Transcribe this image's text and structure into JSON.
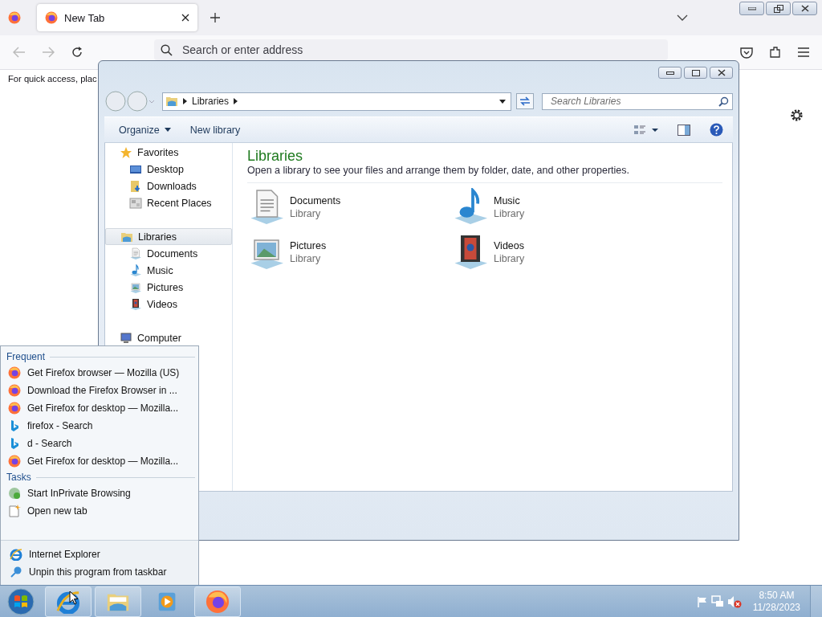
{
  "browser": {
    "tabs": [
      {
        "title": "New Tab",
        "selected": true
      }
    ],
    "address": {
      "placeholder": "Search or enter address"
    },
    "bookmarks_hint": "For quick access, plac"
  },
  "explorer": {
    "breadcrumb": [
      "Libraries"
    ],
    "search": {
      "placeholder": "Search Libraries"
    },
    "toolbar": [
      "Organize",
      "New library"
    ],
    "nav": [
      {
        "label": "Favorites",
        "kind": "star",
        "selected": false,
        "children": [
          {
            "label": "Desktop",
            "kind": "desktop",
            "selected": false
          },
          {
            "label": "Downloads",
            "kind": "downloads",
            "selected": false
          },
          {
            "label": "Recent Places",
            "kind": "recent",
            "selected": false
          }
        ]
      },
      {
        "label": "Libraries",
        "kind": "library",
        "selected": true,
        "children": [
          {
            "label": "Documents",
            "kind": "document",
            "selected": false
          },
          {
            "label": "Music",
            "kind": "music",
            "selected": false
          },
          {
            "label": "Pictures",
            "kind": "pictures",
            "selected": false
          },
          {
            "label": "Videos",
            "kind": "videos",
            "selected": false
          }
        ]
      },
      {
        "label": "Computer",
        "kind": "computer",
        "selected": false
      }
    ],
    "title": "Libraries",
    "description": "Open a library to see your files and arrange them by folder, date, and other properties.",
    "items": [
      {
        "name": "Documents",
        "subtitle": "Library",
        "kind": "document"
      },
      {
        "name": "Music",
        "subtitle": "Library",
        "kind": "music"
      },
      {
        "name": "Pictures",
        "subtitle": "Library",
        "kind": "pictures"
      },
      {
        "name": "Videos",
        "subtitle": "Library",
        "kind": "videos"
      }
    ]
  },
  "jumplist": {
    "sections": [
      {
        "heading": "Frequent",
        "items": [
          {
            "label": "Get Firefox browser — Mozilla (US)",
            "kind": "firefox"
          },
          {
            "label": "Download the Firefox Browser in ...",
            "kind": "firefox"
          },
          {
            "label": "Get Firefox for desktop — Mozilla...",
            "kind": "firefox"
          },
          {
            "label": "firefox - Search",
            "kind": "bing"
          },
          {
            "label": "d - Search",
            "kind": "bing"
          },
          {
            "label": "Get Firefox for desktop — Mozilla...",
            "kind": "firefox"
          }
        ]
      },
      {
        "heading": "Tasks",
        "items": [
          {
            "label": "Start InPrivate Browsing",
            "kind": "inprivate"
          },
          {
            "label": "Open new tab",
            "kind": "newtab"
          }
        ]
      }
    ],
    "pinned": [
      {
        "label": "Internet Explorer",
        "kind": "ie"
      },
      {
        "label": "Unpin this program from taskbar",
        "kind": "unpin"
      }
    ]
  },
  "taskbar": {
    "buttons": [
      {
        "kind": "ie",
        "running": true
      },
      {
        "kind": "explorer",
        "running": true
      },
      {
        "kind": "media",
        "running": false
      },
      {
        "kind": "firefox",
        "running": true
      }
    ],
    "time": "8:50 AM",
    "date": "11/28/2023"
  }
}
